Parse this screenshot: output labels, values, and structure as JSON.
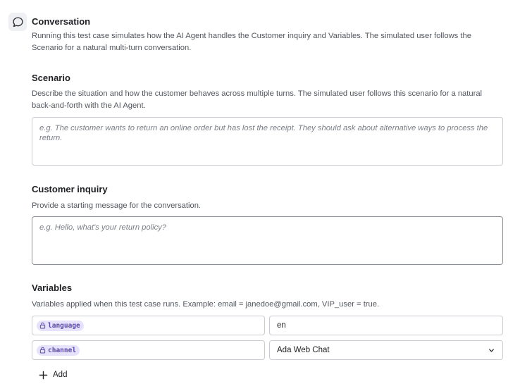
{
  "conversation": {
    "title": "Conversation",
    "description": "Running this test case simulates how the AI Agent handles the Customer inquiry and Variables. The simulated user follows the Scenario for a natural multi-turn conversation.",
    "icon": "chat-bubble-icon"
  },
  "scenario": {
    "title": "Scenario",
    "description": "Describe the situation and how the customer behaves across multiple turns. The simulated user follows this scenario for a natural back-and-forth with the AI Agent.",
    "placeholder": "e.g. The customer wants to return an online order but has lost the receipt. They should ask about alternative ways to process the return.",
    "value": ""
  },
  "inquiry": {
    "title": "Customer inquiry",
    "description": "Provide a starting message for the conversation.",
    "placeholder": "e.g. Hello, what's your return policy?",
    "value": ""
  },
  "variables": {
    "title": "Variables",
    "description": "Variables applied when this test case runs. Example: email = janedoe@gmail.com, VIP_user = true.",
    "rows": [
      {
        "name": "language",
        "value": "en",
        "type": "text"
      },
      {
        "name": "channel",
        "value": "Ada Web Chat",
        "type": "select"
      }
    ],
    "add_label": "Add"
  }
}
